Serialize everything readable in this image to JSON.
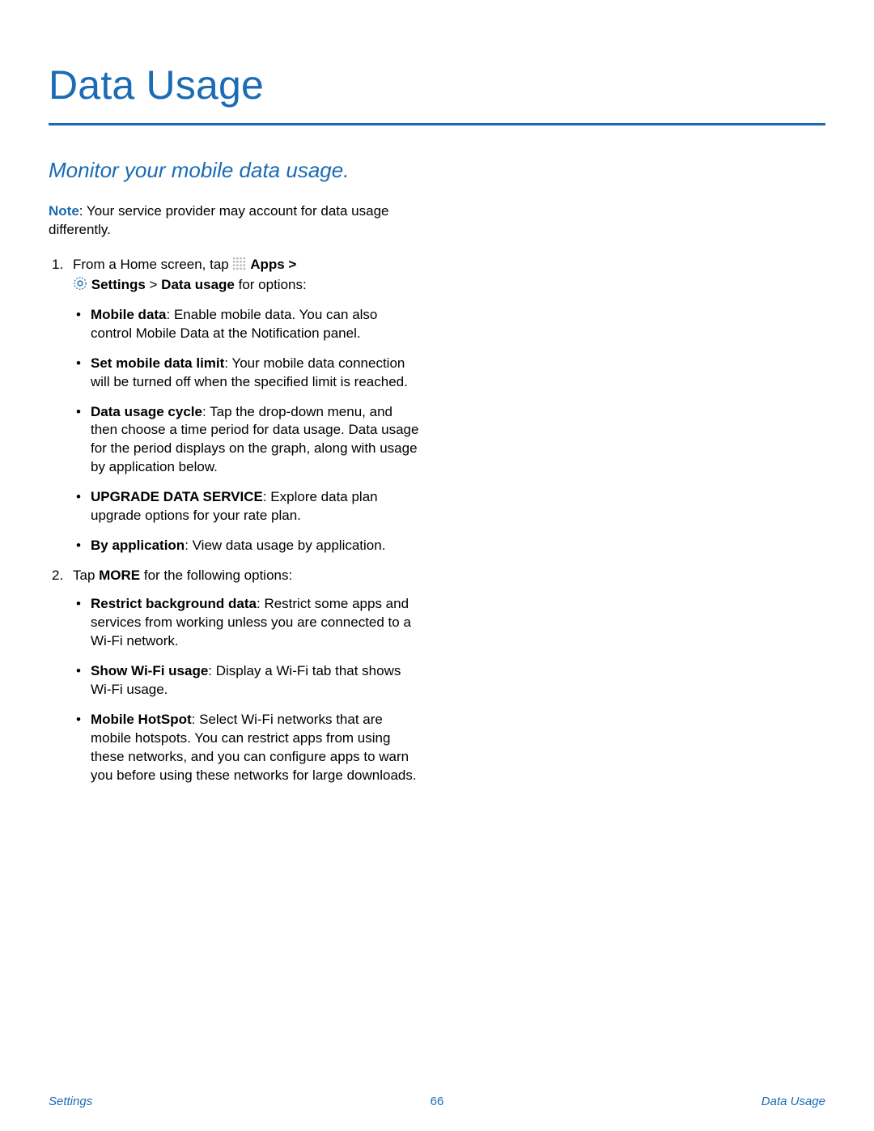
{
  "title": "Data Usage",
  "subtitle": "Monitor your mobile data usage.",
  "note": {
    "label": "Note",
    "text": ": Your service provider may account for data usage differently."
  },
  "step1": {
    "num": "1.",
    "intro_a": "From a Home screen, tap ",
    "apps_label": "Apps",
    "sep1": " > ",
    "settings_label": "Settings",
    "arrow2": " > ",
    "data_usage_label": "Data usage",
    "intro_b": " for options:",
    "bullets": [
      {
        "b": "Mobile data",
        "rest": ": Enable mobile data. You can also control Mobile Data at the Notification panel."
      },
      {
        "b": "Set mobile data limit",
        "rest": ": Your mobile data connection will be turned off when the specified limit is reached."
      },
      {
        "b": "Data usage cycle",
        "rest": ": Tap the drop-down menu, and then choose a time period for data usage. Data usage for the period displays on the graph, along with usage by application below."
      },
      {
        "b": "UPGRADE DATA SERVICE",
        "rest": ": Explore data plan upgrade options for your rate plan."
      },
      {
        "b": "By application",
        "rest": ": View data usage by application."
      }
    ]
  },
  "step2": {
    "num": "2.",
    "intro_a": "Tap ",
    "more_label": "MORE",
    "intro_b": " for the following options:",
    "bullets": [
      {
        "b": "Restrict background data",
        "rest": ": Restrict some apps and services from working unless you are connected to a Wi-Fi network."
      },
      {
        "b": "Show Wi-Fi usage",
        "rest": ": Display a Wi-Fi tab that shows Wi-Fi usage."
      },
      {
        "b": "Mobile HotSpot",
        "rest": ": Select Wi-Fi networks that are mobile hotspots. You can restrict apps from using these networks, and you can configure apps to warn you before using these networks for large downloads."
      }
    ]
  },
  "footer": {
    "left": "Settings",
    "center": "66",
    "right": "Data Usage"
  }
}
